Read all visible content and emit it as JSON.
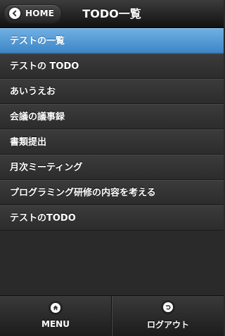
{
  "header": {
    "home_label": "HOME",
    "title": "TODO一覧",
    "home_icon": "chevron-left-icon"
  },
  "todo_list": {
    "items": [
      {
        "label": "テストの一覧",
        "selected": true
      },
      {
        "label": "テストの TODO",
        "selected": false
      },
      {
        "label": "あいうえお",
        "selected": false
      },
      {
        "label": "会議の議事録",
        "selected": false
      },
      {
        "label": "書類提出",
        "selected": false
      },
      {
        "label": "月次ミーティング",
        "selected": false
      },
      {
        "label": "プログラミング研修の内容を考える",
        "selected": false
      },
      {
        "label": "テストのTODO",
        "selected": false
      }
    ]
  },
  "footer": {
    "menu_label": "MENU",
    "menu_icon": "home-icon",
    "logout_label": "ログアウト",
    "logout_icon": "undo-icon"
  },
  "colors": {
    "selected_item": "#4a90d0",
    "item_background": "#333333",
    "header_background": "#1e1e1e"
  }
}
